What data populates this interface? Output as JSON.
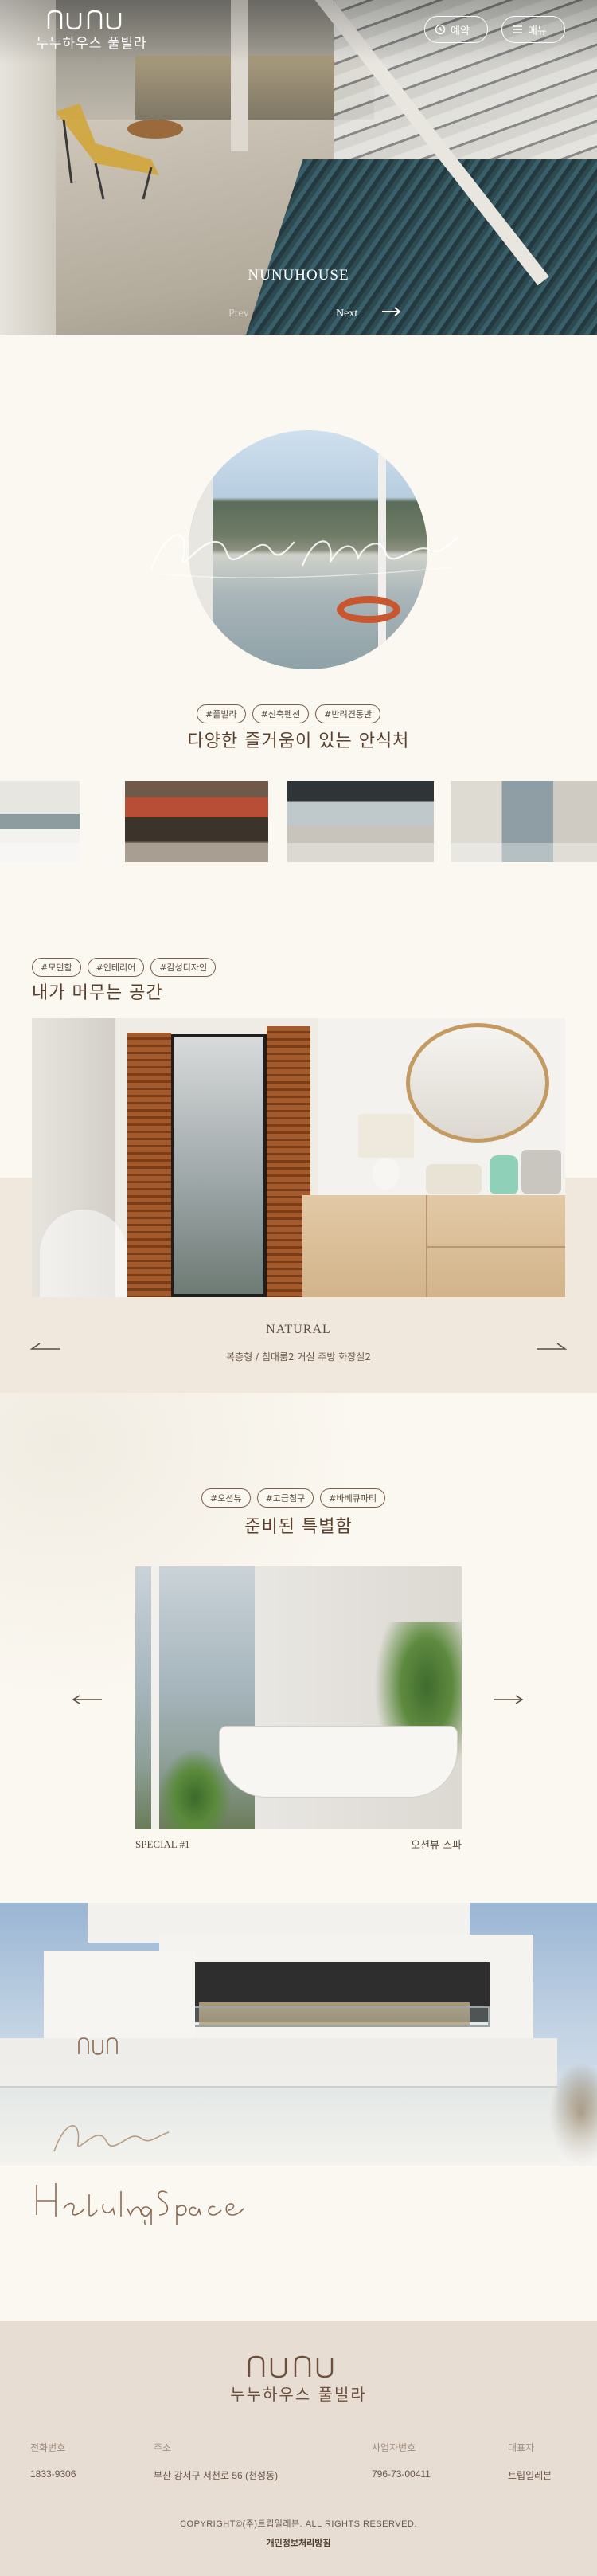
{
  "header": {
    "logo_ko": "누누하우스 풀빌라",
    "reserve_label": "예약",
    "menu_label": "메뉴"
  },
  "hero": {
    "title": "NUNUHOUSE",
    "prev_label": "Prev",
    "next_label": "Next"
  },
  "intro": {
    "tags": [
      "#풀빌라",
      "#신축펜션",
      "#반려견동반"
    ],
    "title": "다양한 즐거움이 있는 안식처"
  },
  "space": {
    "tags": [
      "#모던함",
      "#인테리어",
      "#감성디자인"
    ],
    "title": "내가 머무는 공간",
    "room_name": "NATURAL",
    "room_desc": "복층형 / 침대룸2 거실 주방 화장실2"
  },
  "special": {
    "tags": [
      "#오션뷰",
      "#고급침구",
      "#바베큐파티"
    ],
    "title": "준비된 특별함",
    "caption_left": "SPECIAL #1",
    "caption_right": "오션뷰 스파"
  },
  "footer": {
    "logo_ko": "누누하우스 풀빌라",
    "columns": [
      {
        "label": "전화번호",
        "value": "1833-9306"
      },
      {
        "label": "주소",
        "value": "부산 강서구 서천로 56 (천성동)"
      },
      {
        "label": "사업자번호",
        "value": "796-73-00411"
      },
      {
        "label": "대표자",
        "value": "트립일레븐"
      }
    ],
    "copyright": "COPYRIGHT©(주)트립일레븐. ALL RIGHTS RESERVED.",
    "privacy": "개인정보처리방침"
  },
  "colors": {
    "background": "#fbf8f1",
    "brown": "#5a3f2c",
    "footer_bg": "#e7ddd2",
    "band": "#f0e8dd"
  }
}
